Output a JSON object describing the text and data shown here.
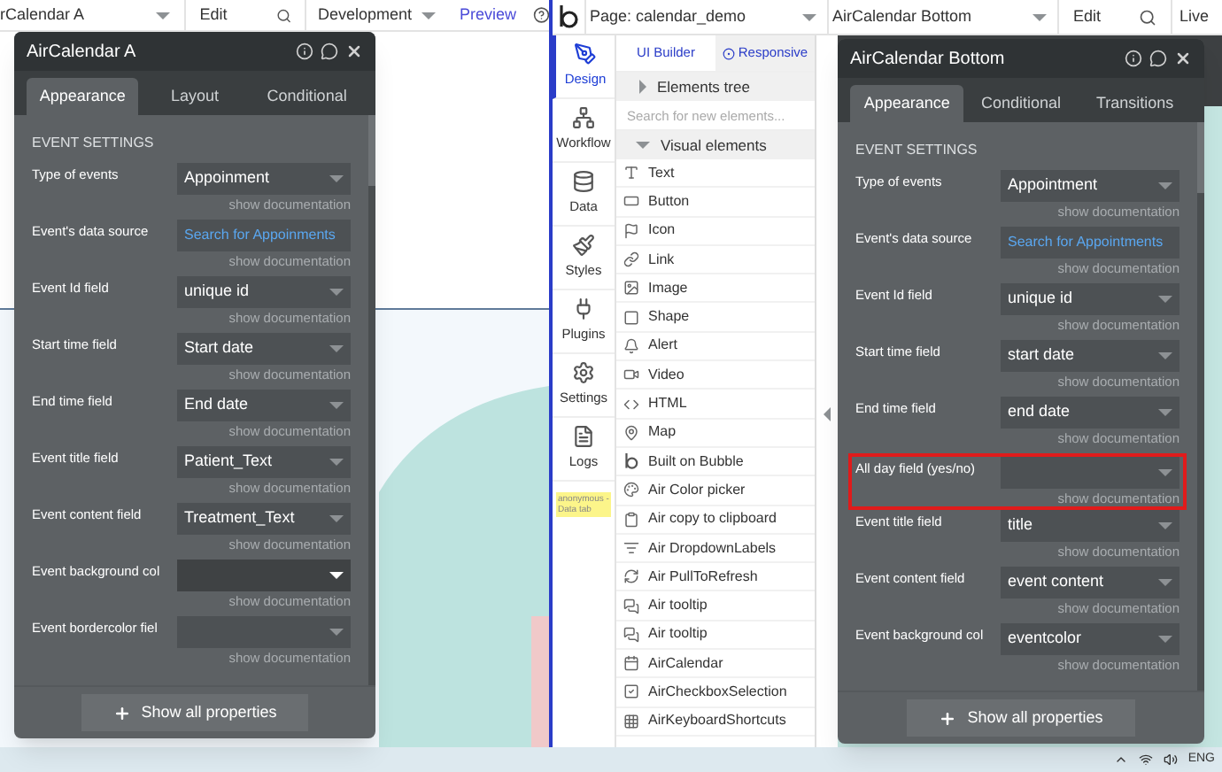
{
  "left_editor": {
    "topbar": {
      "element_dropdown": "rCalendar A",
      "edit": "Edit",
      "mode_dropdown": "Development",
      "preview": "Preview"
    },
    "panel": {
      "title": "AirCalendar A",
      "tabs": [
        {
          "label": "Appearance",
          "selected": true
        },
        {
          "label": "Layout",
          "selected": false
        },
        {
          "label": "Conditional",
          "selected": false
        }
      ],
      "section": "EVENT SETTINGS",
      "rows": [
        {
          "label": "Type of events",
          "kind": "select",
          "value": "Appoinment",
          "focused": false,
          "doc": "show documentation"
        },
        {
          "label": "Event's data source",
          "kind": "link",
          "value": "Search for Appoinments",
          "focused": false,
          "doc": "show documentation"
        },
        {
          "label": "Event Id field",
          "kind": "select",
          "value": "unique id",
          "focused": false,
          "doc": "show documentation"
        },
        {
          "label": "Start time field",
          "kind": "select",
          "value": "Start date",
          "focused": false,
          "doc": "show documentation"
        },
        {
          "label": "End time field",
          "kind": "select",
          "value": "End date",
          "focused": false,
          "doc": "show documentation"
        },
        {
          "label": "Event title field",
          "kind": "select",
          "value": "Patient_Text",
          "focused": false,
          "doc": "show documentation"
        },
        {
          "label": "Event content field",
          "kind": "select",
          "value": "Treatment_Text",
          "focused": false,
          "doc": "show documentation"
        },
        {
          "label": "Event background col",
          "kind": "select",
          "focused": true,
          "doc": "show documentation"
        },
        {
          "label": "Event bordercolor fiel",
          "kind": "select",
          "focused": false,
          "doc": "show documentation"
        }
      ],
      "show_all": "Show all properties"
    }
  },
  "right_editor": {
    "topbar": {
      "page_dropdown": "Page: calendar_demo",
      "element_dropdown": "AirCalendar Bottom",
      "edit": "Edit",
      "live": "Live"
    },
    "sidebar": [
      {
        "label": "Design",
        "selected": true
      },
      {
        "label": "Workflow",
        "selected": false
      },
      {
        "label": "Data",
        "selected": false
      },
      {
        "label": "Styles",
        "selected": false
      },
      {
        "label": "Plugins",
        "selected": false
      },
      {
        "label": "Settings",
        "selected": false
      },
      {
        "label": "Logs",
        "selected": false
      }
    ],
    "note": "anonymous - Data tab",
    "elements_panel": {
      "tabs": [
        {
          "label": "UI Builder",
          "selected": true
        },
        {
          "label": "Responsive",
          "selected": false
        }
      ],
      "tree": {
        "label": "Elements tree",
        "expanded": false
      },
      "search": {
        "placeholder": "Search for new elements..."
      },
      "group": {
        "label": "Visual elements",
        "expanded": true
      },
      "items": [
        "Text",
        "Button",
        "Icon",
        "Link",
        "Image",
        "Shape",
        "Alert",
        "Video",
        "HTML",
        "Map",
        "Built on Bubble",
        "Air Color picker",
        "Air copy to clipboard",
        "Air DropdownLabels",
        "Air PullToRefresh",
        "Air tooltip",
        "Air tooltip",
        "AirCalendar",
        "AirCheckboxSelection",
        "AirKeyboardShortcuts"
      ]
    },
    "panel": {
      "title": "AirCalendar Bottom",
      "tabs": [
        {
          "label": "Appearance",
          "selected": true
        },
        {
          "label": "Conditional",
          "selected": false
        },
        {
          "label": "Transitions",
          "selected": false
        }
      ],
      "section": "EVENT SETTINGS",
      "rows": [
        {
          "label": "Type of events",
          "kind": "select",
          "value": "Appointment",
          "highlighted": false,
          "doc": "show documentation"
        },
        {
          "label": "Event's data source",
          "kind": "link",
          "value": "Search for Appointments",
          "highlighted": false,
          "doc": "show documentation"
        },
        {
          "label": "Event Id field",
          "kind": "select",
          "value": "unique id",
          "highlighted": false,
          "doc": "show documentation"
        },
        {
          "label": "Start time field",
          "kind": "select",
          "value": "start date",
          "highlighted": false,
          "doc": "show documentation"
        },
        {
          "label": "End time field",
          "kind": "select",
          "value": "end date",
          "highlighted": false,
          "doc": "show documentation"
        },
        {
          "label": "All day field (yes/no)",
          "kind": "select",
          "highlighted": true,
          "doc": "show documentation"
        },
        {
          "label": "Event title field",
          "kind": "select",
          "value": "title",
          "highlighted": false,
          "doc": "show documentation"
        },
        {
          "label": "Event content field",
          "kind": "select",
          "value": "event content",
          "highlighted": false,
          "doc": "show documentation"
        },
        {
          "label": "Event background col",
          "kind": "select",
          "value": "eventcolor",
          "highlighted": false,
          "doc": "show documentation"
        }
      ],
      "show_all": "Show all properties"
    }
  },
  "taskbar": {
    "language": "ENG"
  }
}
